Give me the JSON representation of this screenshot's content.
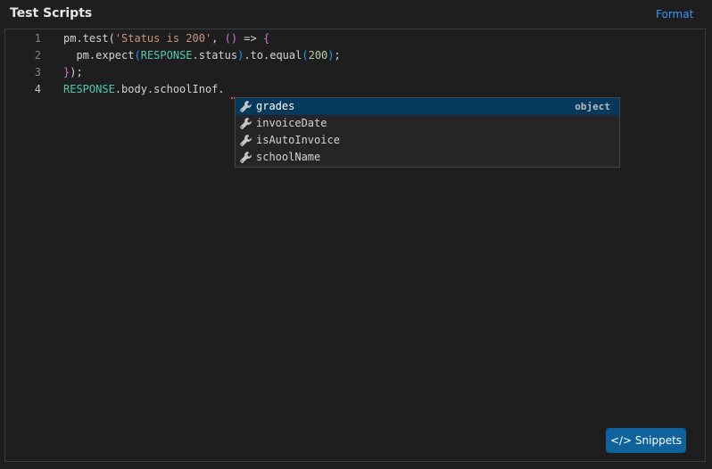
{
  "header": {
    "title": "Test Scripts",
    "format_label": "Format"
  },
  "editor": {
    "line_numbers": [
      "1",
      "2",
      "3",
      "4"
    ],
    "lines": [
      [
        {
          "t": "pm.test(",
          "c": "plain"
        },
        {
          "t": "'Status is 200'",
          "c": "string"
        },
        {
          "t": ", ",
          "c": "plain"
        },
        {
          "t": "()",
          "c": "paren1"
        },
        {
          "t": " => ",
          "c": "plain"
        },
        {
          "t": "{",
          "c": "brace"
        }
      ],
      [
        {
          "t": "  pm.expect",
          "c": "plain"
        },
        {
          "t": "(",
          "c": "paren2"
        },
        {
          "t": "RESPONSE",
          "c": "resp"
        },
        {
          "t": ".status",
          "c": "plain"
        },
        {
          "t": ")",
          "c": "paren2"
        },
        {
          "t": ".to.equal",
          "c": "plain"
        },
        {
          "t": "(",
          "c": "paren2"
        },
        {
          "t": "200",
          "c": "num"
        },
        {
          "t": ")",
          "c": "paren2"
        },
        {
          "t": ";",
          "c": "plain"
        }
      ],
      [
        {
          "t": "}",
          "c": "brace"
        },
        {
          "t": ");",
          "c": "plain"
        }
      ],
      [
        {
          "t": "RESPONSE",
          "c": "resp"
        },
        {
          "t": ".body.schoolInof.",
          "c": "plain"
        }
      ]
    ]
  },
  "suggestions": {
    "items": [
      {
        "label": "grades",
        "detail": "object",
        "selected": true
      },
      {
        "label": "invoiceDate",
        "detail": "",
        "selected": false
      },
      {
        "label": "isAutoInvoice",
        "detail": "",
        "selected": false
      },
      {
        "label": "schoolName",
        "detail": "",
        "selected": false
      }
    ],
    "icon": "wrench-icon"
  },
  "toolbar": {
    "snippets_label": "</> Snippets"
  }
}
